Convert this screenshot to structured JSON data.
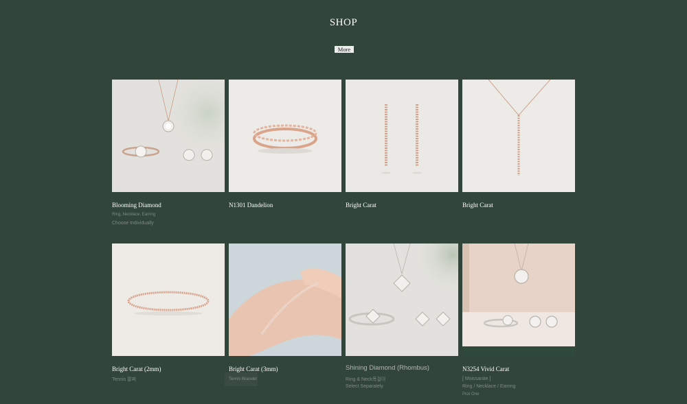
{
  "header": {
    "title": "SHOP",
    "more_label": "More"
  },
  "products": [
    {
      "name": "Blooming Diamond",
      "line1": "Ring, Necklace, Earring",
      "line2": "Choose Individually"
    },
    {
      "name": "N1301 Dandelion"
    },
    {
      "name": "Bright Carat"
    },
    {
      "name": "Bright Carat"
    },
    {
      "name": "Bright Carat (2mm)",
      "line1": "Tennis 팔찌"
    },
    {
      "name": "Bright Carat (3mm)",
      "line1": "Tennis Bracelet"
    },
    {
      "name": "Shining Diamond (Rhombus)",
      "line1": "Ring & Neck목걸이",
      "line2": "Select Separately"
    },
    {
      "name": "N3254 Vivid Carat",
      "line1": "[ Moissanite ]",
      "line2": "Ring / Necklace / Earring",
      "line3": "Pick One"
    }
  ],
  "colors": {
    "background": "#31453a",
    "title": "#ffffff",
    "muted": "#7f8c84"
  }
}
